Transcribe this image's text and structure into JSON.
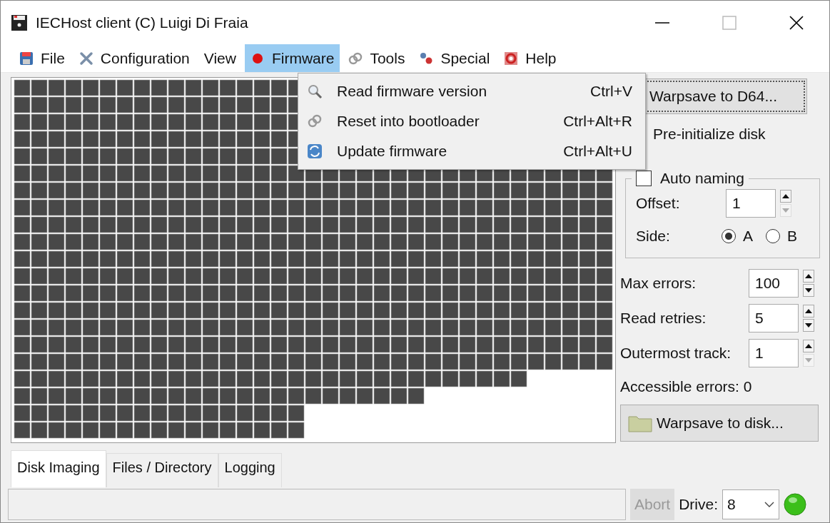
{
  "window": {
    "title": "IECHost client (C) Luigi Di Fraia"
  },
  "menu": [
    {
      "label": "File",
      "selected": false
    },
    {
      "label": "Configuration",
      "selected": false
    },
    {
      "label": "View",
      "selected": false
    },
    {
      "label": "Firmware",
      "selected": true
    },
    {
      "label": "Tools",
      "selected": false
    },
    {
      "label": "Special",
      "selected": false
    },
    {
      "label": "Help",
      "selected": false
    }
  ],
  "dropdown": {
    "items": [
      {
        "label": "Read firmware version",
        "shortcut": "Ctrl+V"
      },
      {
        "label": "Reset into bootloader",
        "shortcut": "Ctrl+Alt+R"
      },
      {
        "label": "Update firmware",
        "shortcut": "Ctrl+Alt+U"
      }
    ]
  },
  "panel": {
    "warpsave_d64": {
      "label": "Warpsave to D64..."
    },
    "preinit": {
      "label": "Pre-initialize disk"
    },
    "auto_naming": {
      "label": "Auto naming",
      "checked": false,
      "offset": {
        "label": "Offset:",
        "value": "1",
        "down_disabled": true
      },
      "side": {
        "label": "Side:",
        "options": [
          {
            "label": "A",
            "selected": true
          },
          {
            "label": "B",
            "selected": false
          }
        ]
      }
    },
    "spins": [
      {
        "label": "Max errors:",
        "value": "100",
        "down_disabled": false
      },
      {
        "label": "Read retries:",
        "value": "5",
        "down_disabled": false
      },
      {
        "label": "Outermost track:",
        "value": "1",
        "down_disabled": true
      }
    ],
    "accessible_errors": "Accessible errors: 0",
    "warpsave_disk": {
      "label": "Warpsave to disk..."
    }
  },
  "tabs": [
    {
      "label": "Disk Imaging",
      "selected": true
    },
    {
      "label": "Files / Directory",
      "selected": false
    },
    {
      "label": "Logging",
      "selected": false
    }
  ],
  "status_bar": {
    "abort": {
      "label": "Abort",
      "disabled": true
    },
    "drive_label": "Drive:",
    "drive_value": "8",
    "led_on": true
  }
}
